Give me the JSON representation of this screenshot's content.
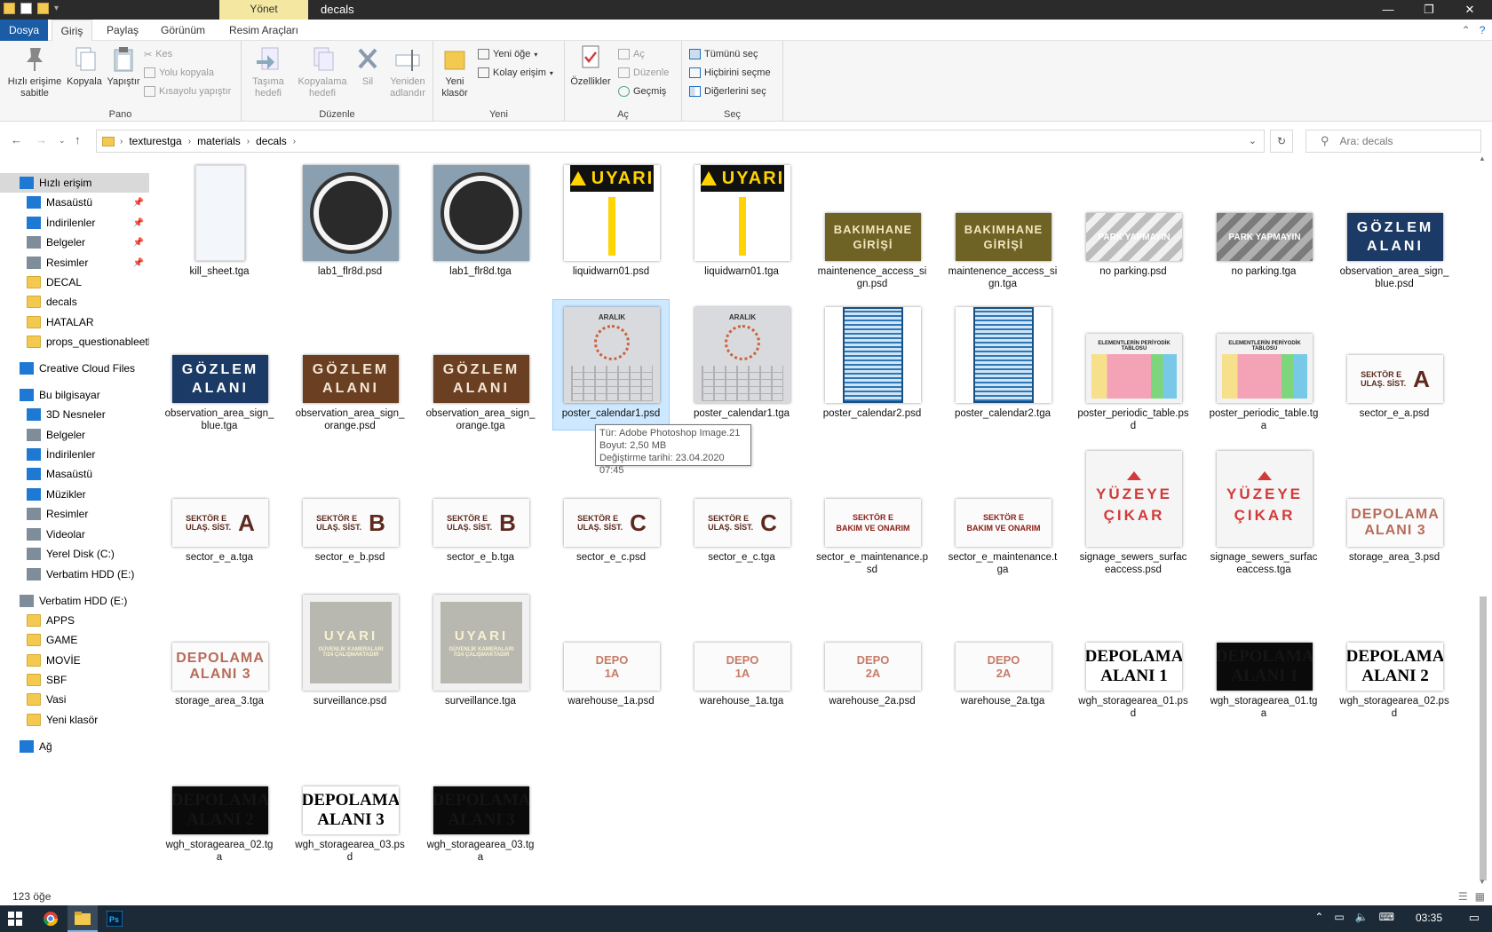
{
  "titlebar": {
    "contextual_tab": "Yönet",
    "window_title": "decals",
    "minimize": "—",
    "maximize": "❐",
    "close": "✕"
  },
  "ribbon_tabs": [
    "Dosya",
    "Giriş",
    "Paylaş",
    "Görünüm",
    "Resim Araçları"
  ],
  "ribbon": {
    "pano": {
      "label": "Pano",
      "pin": "Hızlı erişime sabitle",
      "copy": "Kopyala",
      "paste": "Yapıştır",
      "cut": "Kes",
      "copy_path": "Yolu kopyala",
      "paste_shortcut": "Kısayolu yapıştır"
    },
    "duzenle": {
      "label": "Düzenle",
      "move_to": "Taşıma hedefi",
      "copy_to": "Kopyalama hedefi",
      "delete": "Sil",
      "rename": "Yeniden adlandır"
    },
    "yeni": {
      "label": "Yeni",
      "new_folder": "Yeni klasör",
      "new_item": "Yeni öğe",
      "easy_access": "Kolay erişim"
    },
    "ac": {
      "label": "Aç",
      "properties": "Özellikler",
      "open": "Aç",
      "edit": "Düzenle",
      "history": "Geçmiş"
    },
    "sec": {
      "label": "Seç",
      "select_all": "Tümünü seç",
      "select_none": "Hiçbirini seçme",
      "invert": "Diğerlerini seç"
    }
  },
  "address": {
    "crumbs": [
      "texturestga",
      "materials",
      "decals"
    ],
    "search_placeholder": "Ara: decals"
  },
  "sidebar": [
    {
      "label": "Hızlı erişim",
      "icon": "star-icon",
      "selected": true
    },
    {
      "label": "Masaüstü",
      "icon": "desktop-icon",
      "pinned": true
    },
    {
      "label": "İndirilenler",
      "icon": "download-icon",
      "pinned": true
    },
    {
      "label": "Belgeler",
      "icon": "documents-icon",
      "pinned": true
    },
    {
      "label": "Resimler",
      "icon": "pictures-icon",
      "pinned": true
    },
    {
      "label": "DECAL",
      "icon": "folder-icon"
    },
    {
      "label": "decals",
      "icon": "folder-icon"
    },
    {
      "label": "HATALAR",
      "icon": "folder-icon"
    },
    {
      "label": "props_questionableethics",
      "icon": "folder-icon"
    },
    {
      "label": "Creative Cloud Files",
      "icon": "creative-cloud-icon"
    },
    {
      "label": "Bu bilgisayar",
      "icon": "computer-icon"
    },
    {
      "label": "3D Nesneler",
      "icon": "3d-objects-icon"
    },
    {
      "label": "Belgeler",
      "icon": "documents-icon"
    },
    {
      "label": "İndirilenler",
      "icon": "download-icon"
    },
    {
      "label": "Masaüstü",
      "icon": "desktop-icon"
    },
    {
      "label": "Müzikler",
      "icon": "music-icon"
    },
    {
      "label": "Resimler",
      "icon": "pictures-icon"
    },
    {
      "label": "Videolar",
      "icon": "videos-icon"
    },
    {
      "label": "Yerel Disk (C:)",
      "icon": "disk-icon"
    },
    {
      "label": "Verbatim HDD (E:)",
      "icon": "drive-icon"
    },
    {
      "label": "Verbatim HDD (E:)",
      "icon": "drive-icon"
    },
    {
      "label": "APPS",
      "icon": "folder-icon"
    },
    {
      "label": "GAME",
      "icon": "folder-icon"
    },
    {
      "label": "MOVİE",
      "icon": "folder-icon"
    },
    {
      "label": "SBF",
      "icon": "folder-icon"
    },
    {
      "label": "Vasi",
      "icon": "folder-icon"
    },
    {
      "label": "Yeni klasör",
      "icon": "folder-icon"
    },
    {
      "label": "Ağ",
      "icon": "network-icon"
    }
  ],
  "files": [
    {
      "name": "kill_sheet.tga",
      "kind": "kill",
      "text": ""
    },
    {
      "name": "lab1_flr8d.psd",
      "kind": "lab",
      "text": ""
    },
    {
      "name": "lab1_flr8d.tga",
      "kind": "lab",
      "text": ""
    },
    {
      "name": "liquidwarn01.psd",
      "kind": "uyari",
      "text": "UYARI"
    },
    {
      "name": "liquidwarn01.tga",
      "kind": "uyari",
      "text": "UYARI"
    },
    {
      "name": "maintenence_access_sign.psd",
      "kind": "olive",
      "text": "BAKIMHANE\nGİRİŞİ"
    },
    {
      "name": "maintenence_access_sign.tga",
      "kind": "olive",
      "text": "BAKIMHANE\nGİRİŞİ"
    },
    {
      "name": "no parking.psd",
      "kind": "noparking",
      "text": "PARK YAPMAYIN"
    },
    {
      "name": "no parking.tga",
      "kind": "noparking-dk",
      "text": "PARK YAPMAYIN"
    },
    {
      "name": "observation_area_sign_blue.psd",
      "kind": "blue",
      "text": "GÖZLEM\nALANI"
    },
    {
      "name": "observation_area_sign_blue.tga",
      "kind": "blue",
      "text": "GÖZLEM\nALANI"
    },
    {
      "name": "observation_area_sign_orange.psd",
      "kind": "rust",
      "text": "GÖZLEM\nALANI"
    },
    {
      "name": "observation_area_sign_orange.tga",
      "kind": "rust",
      "text": "GÖZLEM\nALANI"
    },
    {
      "name": "poster_calendar1.psd",
      "kind": "cal",
      "text": "ARALIK",
      "selected": true
    },
    {
      "name": "poster_calendar1.tga",
      "kind": "cal",
      "text": "ARALIK"
    },
    {
      "name": "poster_calendar2.psd",
      "kind": "cal2",
      "text": ""
    },
    {
      "name": "poster_calendar2.tga",
      "kind": "cal2",
      "text": ""
    },
    {
      "name": "poster_periodic_table.psd",
      "kind": "periodic",
      "text": "ELEMENTLERİN PERİYODİK TABLOSU"
    },
    {
      "name": "poster_periodic_table.tga",
      "kind": "periodic",
      "text": "ELEMENTLERİN PERİYODİK TABLOSU"
    },
    {
      "name": "sector_e_a.psd",
      "kind": "sector",
      "text": "SEKTÖR E\nULAŞ. SİST.",
      "big": "A"
    },
    {
      "name": "sector_e_a.tga",
      "kind": "sector",
      "text": "SEKTÖR E\nULAŞ. SİST.",
      "big": "A"
    },
    {
      "name": "sector_e_b.psd",
      "kind": "sector",
      "text": "SEKTÖR E\nULAŞ. SİST.",
      "big": "B"
    },
    {
      "name": "sector_e_b.tga",
      "kind": "sector",
      "text": "SEKTÖR E\nULAŞ. SİST.",
      "big": "B"
    },
    {
      "name": "sector_e_c.psd",
      "kind": "sector",
      "text": "SEKTÖR E\nULAŞ. SİST.",
      "big": "C"
    },
    {
      "name": "sector_e_c.tga",
      "kind": "sector",
      "text": "SEKTÖR E\nULAŞ. SİST.",
      "big": "C"
    },
    {
      "name": "sector_e_maintenance.psd",
      "kind": "maint",
      "text": "SEKTÖR E\nBAKIM VE ONARIM"
    },
    {
      "name": "sector_e_maintenance.tga",
      "kind": "maint",
      "text": "SEKTÖR E\nBAKIM VE ONARIM"
    },
    {
      "name": "signage_sewers_surfaceaccess.psd",
      "kind": "yuzeye",
      "text": "YÜZEYE\nÇIKAR"
    },
    {
      "name": "signage_sewers_surfaceaccess.tga",
      "kind": "yuzeye",
      "text": "YÜZEYE\nÇIKAR"
    },
    {
      "name": "storage_area_3.psd",
      "kind": "depo",
      "text": "DEPOLAMA\nALANI 3"
    },
    {
      "name": "storage_area_3.tga",
      "kind": "depo",
      "text": "DEPOLAMA\nALANI 3"
    },
    {
      "name": "surveillance.psd",
      "kind": "surv",
      "text": "UYARI",
      "sub": "GÜVENLİK KAMERALARI\n7/24 ÇALIŞMAKTADIR"
    },
    {
      "name": "surveillance.tga",
      "kind": "surv",
      "text": "UYARI",
      "sub": "GÜVENLİK KAMERALARI\n7/24 ÇALIŞMAKTADIR"
    },
    {
      "name": "warehouse_1a.psd",
      "kind": "depo-s",
      "text": "DEPO\n1A"
    },
    {
      "name": "warehouse_1a.tga",
      "kind": "depo-s",
      "text": "DEPO\n1A"
    },
    {
      "name": "warehouse_2a.psd",
      "kind": "depo-s",
      "text": "DEPO\n2A"
    },
    {
      "name": "warehouse_2a.tga",
      "kind": "depo-s",
      "text": "DEPO\n2A"
    },
    {
      "name": "wgh_storagearea_01.psd",
      "kind": "wgh",
      "text": "DEPOLAMA\nALANI 1"
    },
    {
      "name": "wgh_storagearea_01.tga",
      "kind": "wgh-dk",
      "text": "DEPOLAMA\nALANI 1"
    },
    {
      "name": "wgh_storagearea_02.psd",
      "kind": "wgh",
      "text": "DEPOLAMA\nALANI 2"
    },
    {
      "name": "wgh_storagearea_02.tga",
      "kind": "wgh-dk",
      "text": "DEPOLAMA\nALANI 2"
    },
    {
      "name": "wgh_storagearea_03.psd",
      "kind": "wgh",
      "text": "DEPOLAMA\nALANI 3"
    },
    {
      "name": "wgh_storagearea_03.tga",
      "kind": "wgh-dk",
      "text": "DEPOLAMA\nALANI 3"
    }
  ],
  "tooltip": {
    "type": "Tür: Adobe Photoshop Image.21",
    "size": "Boyut: 2,50 MB",
    "modified": "Değiştirme tarihi: 23.04.2020 07:45"
  },
  "status": {
    "count": "123 öğe"
  },
  "taskbar": {
    "time": "03:35",
    "apps": [
      "start-icon",
      "chrome-icon",
      "file-explorer-icon",
      "photoshop-icon"
    ]
  }
}
